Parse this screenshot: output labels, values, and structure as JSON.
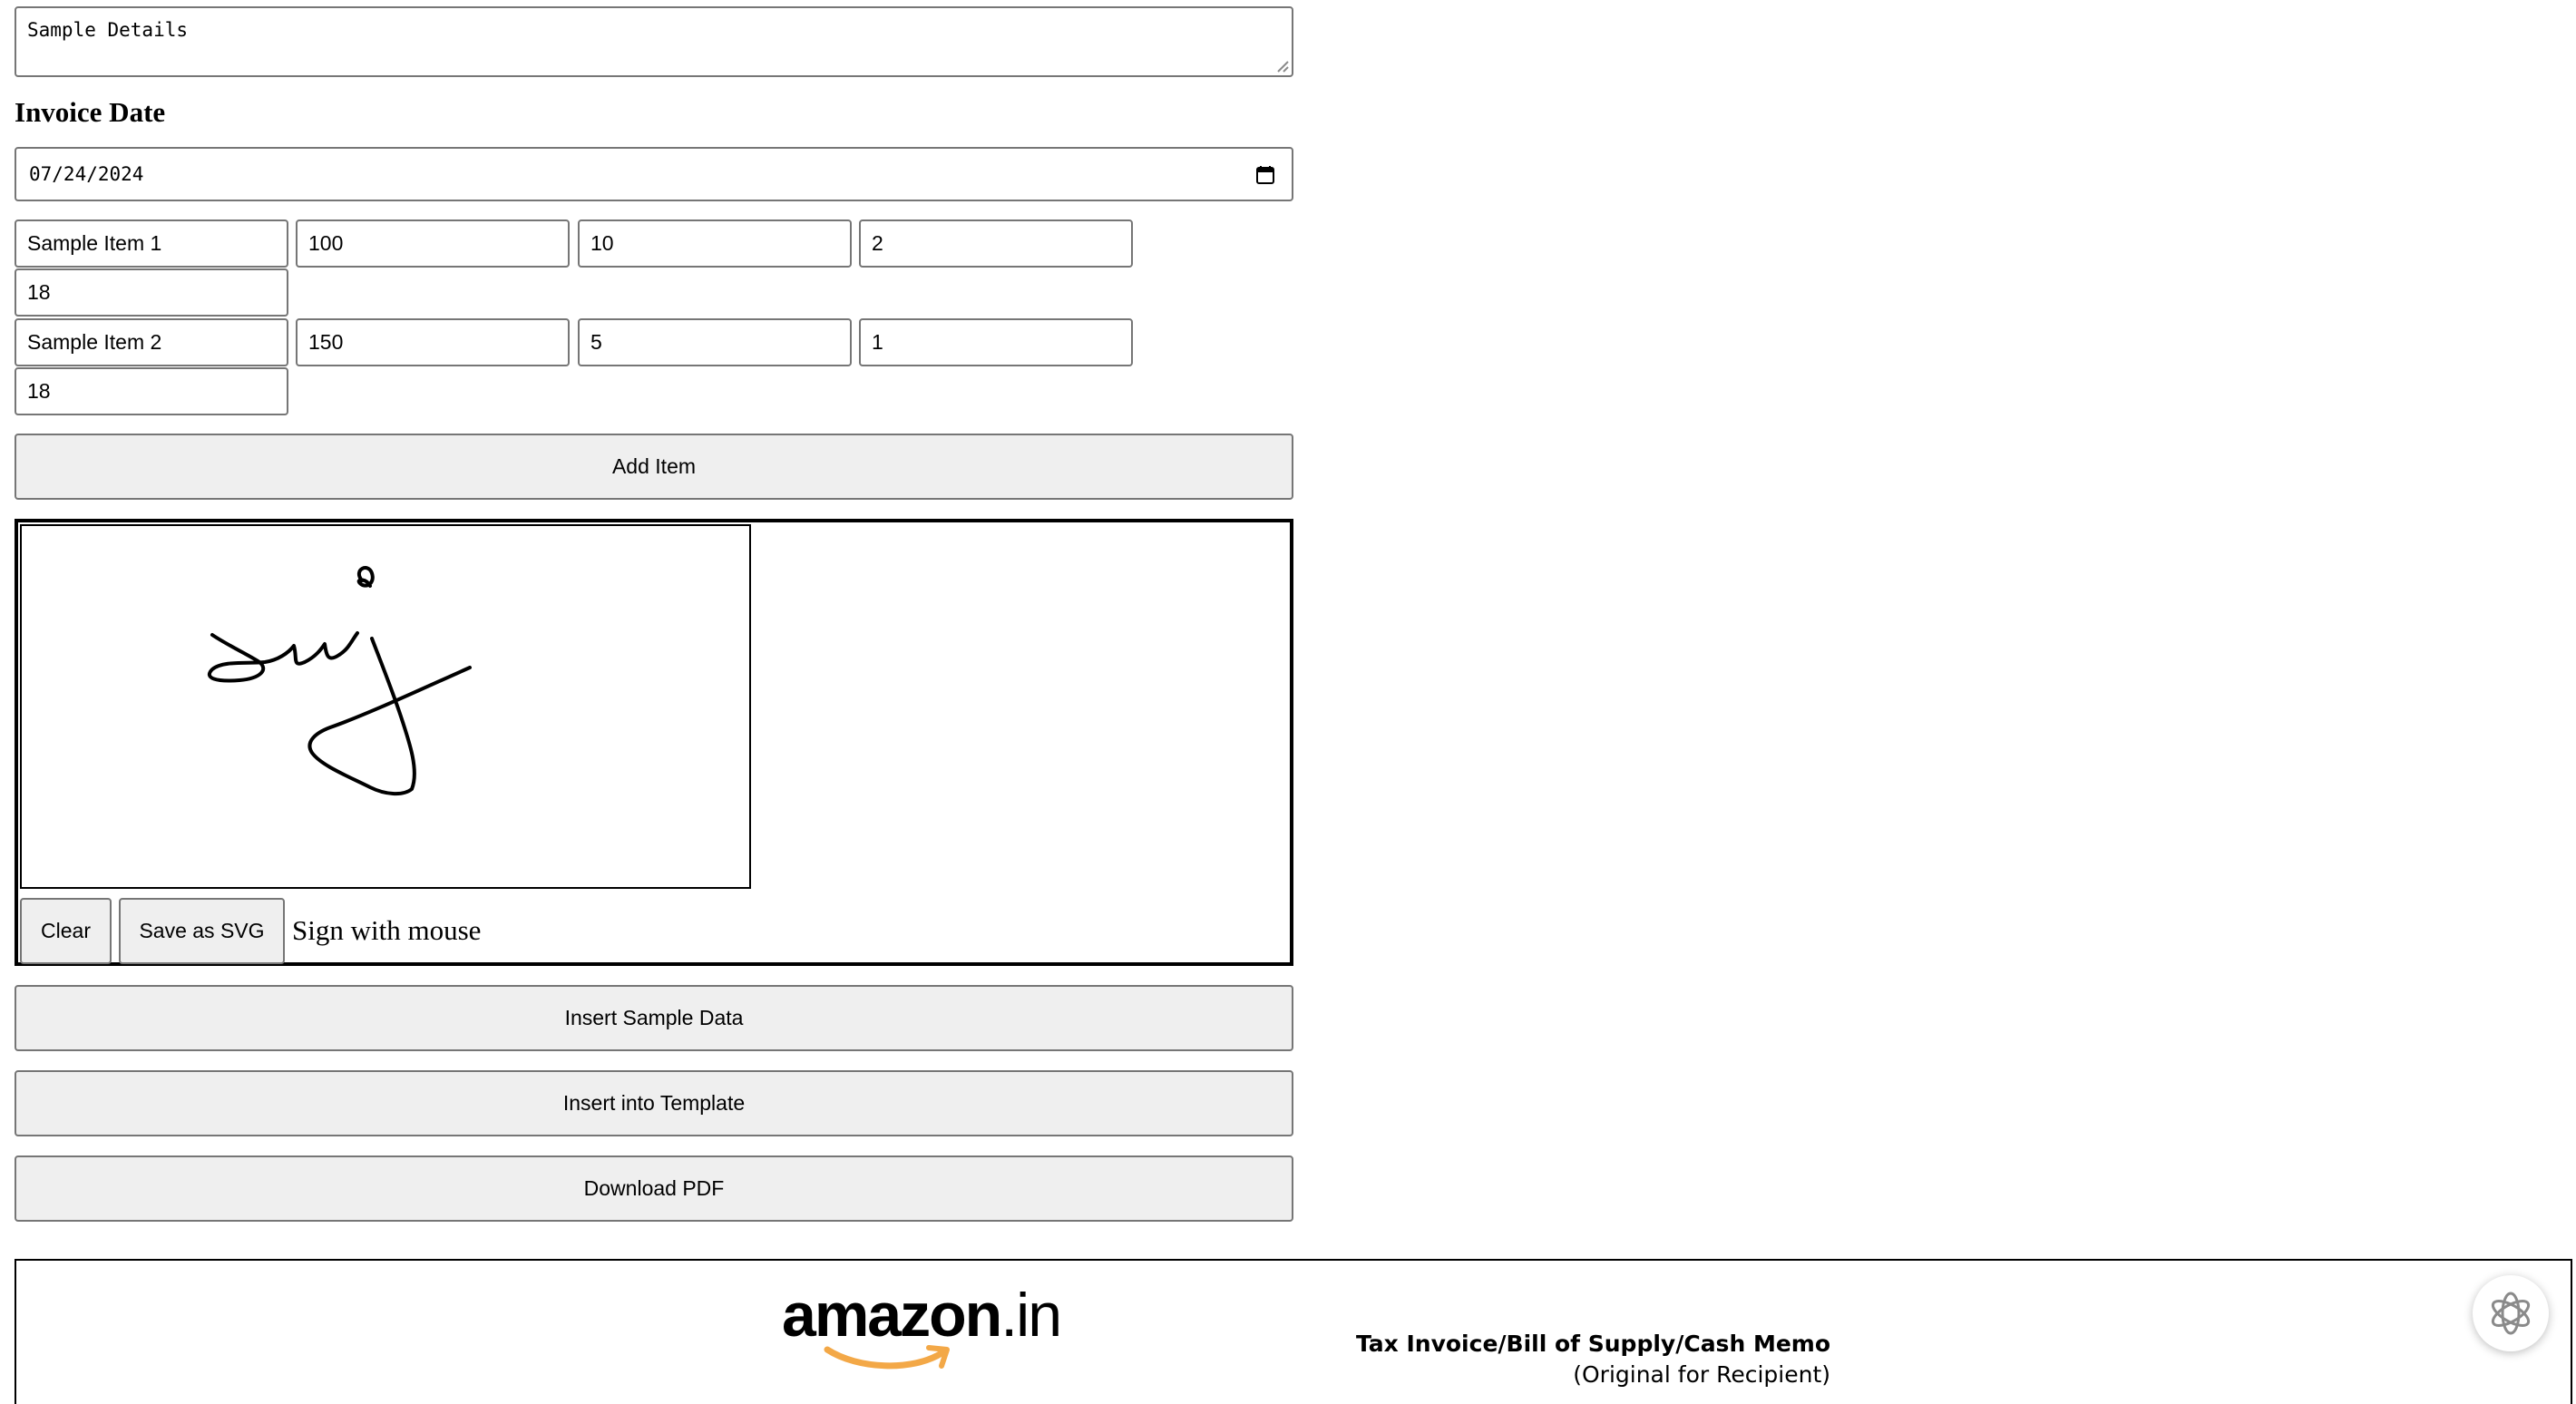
{
  "details": {
    "value": "Sample Details"
  },
  "invoice_date": {
    "label": "Invoice Date",
    "value": "07/24/2024"
  },
  "items": [
    {
      "name": "Sample Item 1",
      "price": "100",
      "discount": "10",
      "quantity": "2",
      "tax": "18"
    },
    {
      "name": "Sample Item 2",
      "price": "150",
      "discount": "5",
      "quantity": "1",
      "tax": "18"
    }
  ],
  "buttons": {
    "add_item": "Add Item",
    "clear": "Clear",
    "save_svg": "Save as SVG",
    "insert_sample": "Insert Sample Data",
    "insert_template": "Insert into Template",
    "download_pdf": "Download PDF"
  },
  "signature": {
    "hint": "Sign with mouse"
  },
  "template": {
    "logo_text": "amazon",
    "logo_tld": ".in",
    "title": "Tax Invoice/Bill of Supply/Cash Memo",
    "subtitle": "(Original for Recipient)"
  },
  "icons": {
    "calendar": "calendar-icon",
    "resize": "resize-grip-icon",
    "assistant": "openai-icon",
    "logo_smile": "amazon-smile-arrow"
  },
  "colors": {
    "logo_arrow": "#f3a847",
    "button_bg": "#efefef",
    "border": "#767676"
  }
}
